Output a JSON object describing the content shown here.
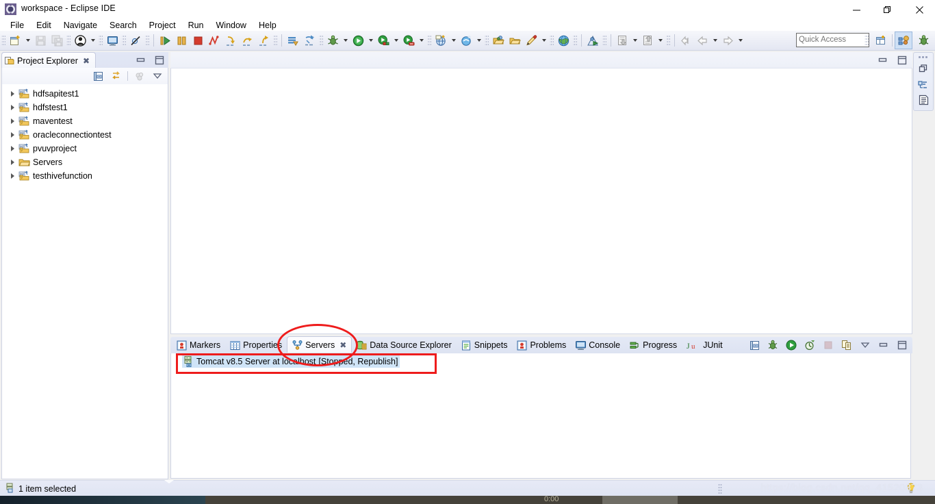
{
  "window": {
    "title": "workspace - Eclipse IDE",
    "icon": "eclipse-icon",
    "controls": {
      "minimize": "—",
      "maximize": "❐",
      "close": "✕"
    }
  },
  "menubar": {
    "items": [
      "File",
      "Edit",
      "Navigate",
      "Search",
      "Project",
      "Run",
      "Window",
      "Help"
    ]
  },
  "toolbar": {
    "quick_access_placeholder": "Quick Access",
    "groups": [
      {
        "name": "file-group",
        "buttons": [
          {
            "icon": "new-wizard-icon",
            "dropdown": true
          },
          {
            "icon": "save-icon",
            "dropdown": false,
            "disabled": true
          },
          {
            "icon": "save-all-icon",
            "dropdown": false,
            "disabled": true
          }
        ]
      },
      {
        "name": "user-group",
        "buttons": [
          {
            "icon": "user-account-icon",
            "dropdown": true
          }
        ]
      },
      {
        "name": "terminal-group",
        "buttons": [
          {
            "icon": "open-console-icon",
            "dropdown": false
          }
        ]
      },
      {
        "name": "breakpoint-group",
        "buttons": [
          {
            "icon": "skip-all-breakpoints-icon",
            "dropdown": false
          }
        ]
      },
      {
        "name": "debug-control-group",
        "buttons": [
          {
            "icon": "resume-icon",
            "dropdown": false
          },
          {
            "icon": "suspend-icon",
            "dropdown": false
          },
          {
            "icon": "terminate-icon",
            "dropdown": false
          },
          {
            "icon": "disconnect-icon",
            "dropdown": false
          },
          {
            "icon": "step-into-icon",
            "dropdown": false
          },
          {
            "icon": "step-over-icon",
            "dropdown": false
          },
          {
            "icon": "step-return-icon",
            "dropdown": false
          }
        ]
      },
      {
        "name": "server-group",
        "buttons": [
          {
            "icon": "publish-icon",
            "dropdown": false
          },
          {
            "icon": "run-on-server-icon",
            "dropdown": false
          }
        ]
      },
      {
        "name": "launch-group",
        "buttons": [
          {
            "icon": "debug-icon",
            "dropdown": true
          },
          {
            "icon": "run-icon",
            "dropdown": true
          },
          {
            "icon": "run-server-icon",
            "dropdown": true
          },
          {
            "icon": "profile-icon",
            "dropdown": true
          }
        ]
      },
      {
        "name": "new-group",
        "buttons": [
          {
            "icon": "new-web-project-icon",
            "dropdown": true
          },
          {
            "icon": "new-search-icon",
            "dropdown": true
          }
        ]
      },
      {
        "name": "folder-group",
        "buttons": [
          {
            "icon": "open-type-icon",
            "dropdown": false
          },
          {
            "icon": "open-task-icon",
            "dropdown": false
          },
          {
            "icon": "pencil-icon",
            "dropdown": true
          }
        ]
      },
      {
        "name": "web-group",
        "buttons": [
          {
            "icon": "web-browser-icon",
            "dropdown": false
          }
        ]
      },
      {
        "name": "person-group",
        "buttons": [
          {
            "icon": "run-last-tool-icon",
            "dropdown": false
          }
        ]
      },
      {
        "name": "annotation-group",
        "buttons": [
          {
            "icon": "previous-annotation-icon",
            "dropdown": true
          },
          {
            "icon": "next-annotation-icon",
            "dropdown": true
          }
        ]
      },
      {
        "name": "nav-group",
        "buttons": [
          {
            "icon": "back-to-icon",
            "dropdown": false
          },
          {
            "icon": "backward-icon",
            "dropdown": true
          },
          {
            "icon": "forward-icon",
            "dropdown": true
          }
        ]
      }
    ],
    "perspective_buttons": [
      {
        "icon": "open-perspective-icon",
        "active": false
      },
      {
        "icon": "java-ee-perspective-icon",
        "active": true
      },
      {
        "icon": "debug-perspective-icon",
        "active": false
      }
    ]
  },
  "project_explorer": {
    "tab_label": "Project Explorer",
    "tab_icon": "project-explorer-icon",
    "close_glyph": "✖",
    "view_buttons": [
      {
        "icon": "minimize-view-icon"
      },
      {
        "icon": "restore-view-icon"
      }
    ],
    "toolbar_buttons": [
      {
        "icon": "collapse-all-icon"
      },
      {
        "icon": "link-with-editor-icon"
      },
      {
        "icon": "focus-on-active-task-icon",
        "disabled": true
      },
      {
        "icon": "view-menu-icon"
      }
    ],
    "items": [
      {
        "label": "hdfsapitest1",
        "icon": "maven-project-icon",
        "expandable": true
      },
      {
        "label": "hdfstest1",
        "icon": "maven-project-icon",
        "expandable": true
      },
      {
        "label": "maventest",
        "icon": "maven-project-icon",
        "expandable": true
      },
      {
        "label": "oracleconnectiontest",
        "icon": "maven-project-icon",
        "expandable": true
      },
      {
        "label": "pvuvproject",
        "icon": "maven-project-icon",
        "expandable": true
      },
      {
        "label": "Servers",
        "icon": "folder-icon",
        "expandable": true
      },
      {
        "label": "testhivefunction",
        "icon": "maven-project-icon",
        "expandable": true
      }
    ]
  },
  "editor": {
    "buttons": [
      {
        "icon": "minimize-editor-icon"
      },
      {
        "icon": "maximize-editor-icon"
      }
    ]
  },
  "bottom_panel": {
    "tabs": [
      {
        "label": "Markers",
        "icon": "markers-icon",
        "active": false,
        "closable": false
      },
      {
        "label": "Properties",
        "icon": "properties-icon",
        "active": false,
        "closable": false
      },
      {
        "label": "Servers",
        "icon": "servers-icon",
        "active": true,
        "closable": true
      },
      {
        "label": "Data Source Explorer",
        "icon": "data-source-explorer-icon",
        "active": false,
        "closable": false
      },
      {
        "label": "Snippets",
        "icon": "snippets-icon",
        "active": false,
        "closable": false
      },
      {
        "label": "Problems",
        "icon": "problems-icon",
        "active": false,
        "closable": false
      },
      {
        "label": "Console",
        "icon": "console-icon",
        "active": false,
        "closable": false
      },
      {
        "label": "Progress",
        "icon": "progress-icon",
        "active": false,
        "closable": false
      },
      {
        "label": "JUnit",
        "icon": "junit-icon",
        "active": false,
        "closable": false
      }
    ],
    "close_glyph": "✖",
    "toolbar_buttons": [
      {
        "icon": "collapse-all-icon"
      },
      {
        "icon": "debug-server-icon"
      },
      {
        "icon": "start-server-icon"
      },
      {
        "icon": "profile-server-icon"
      },
      {
        "icon": "stop-server-icon",
        "disabled": true
      },
      {
        "icon": "publish-server-icon"
      },
      {
        "icon": "view-menu-icon"
      },
      {
        "icon": "minimize-view-icon"
      },
      {
        "icon": "maximize-view-icon"
      }
    ],
    "servers": [
      {
        "name": "Tomcat v8.5 Server at localhost",
        "state": "[Stopped, Republish]",
        "icon": "tomcat-server-icon",
        "selected": true
      }
    ]
  },
  "right_bar": {
    "buttons": [
      {
        "icon": "restore-icon"
      },
      {
        "icon": "outline-view-icon"
      },
      {
        "icon": "task-list-icon"
      }
    ]
  },
  "status_bar": {
    "icon": "selection-icon",
    "text": "1 item selected",
    "watermark": "https://blog.csdn.net/qq_41520873",
    "right_icon": "tip-of-the-day-icon"
  },
  "annotations": {
    "color": "#ee1c1c",
    "ellipse_target": "Servers tab",
    "rect_target": "Tomcat v8.5 Server at localhost [Stopped, Republish]"
  },
  "taskbar": {
    "clock": "0:00"
  }
}
